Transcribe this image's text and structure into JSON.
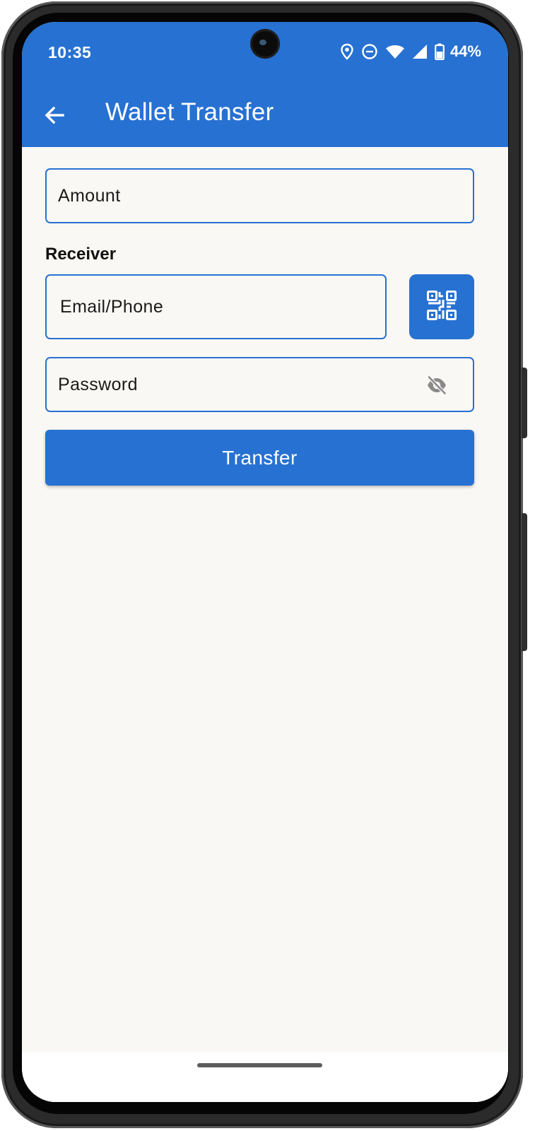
{
  "status_bar": {
    "time": "10:35",
    "battery_percent": "44%",
    "icons": [
      "location-icon",
      "do-not-disturb-icon",
      "wifi-icon",
      "cell-signal-icon",
      "battery-icon"
    ]
  },
  "toolbar": {
    "title": "Wallet Transfer",
    "back_icon": "arrow-left-icon"
  },
  "form": {
    "amount": {
      "placeholder": "Amount",
      "value": ""
    },
    "receiver_label": "Receiver",
    "receiver": {
      "placeholder": "Email/Phone",
      "value": ""
    },
    "qr_icon": "qr-code-scanner-icon",
    "password": {
      "placeholder": "Password",
      "value": "",
      "visibility_icon": "eye-off-icon"
    },
    "transfer_label": "Transfer"
  },
  "colors": {
    "primary": "#2771d2",
    "background": "#faf8f4",
    "on_primary": "#ffffff",
    "text": "#1a1a1a",
    "hint_icon": "#8a8a8a"
  }
}
